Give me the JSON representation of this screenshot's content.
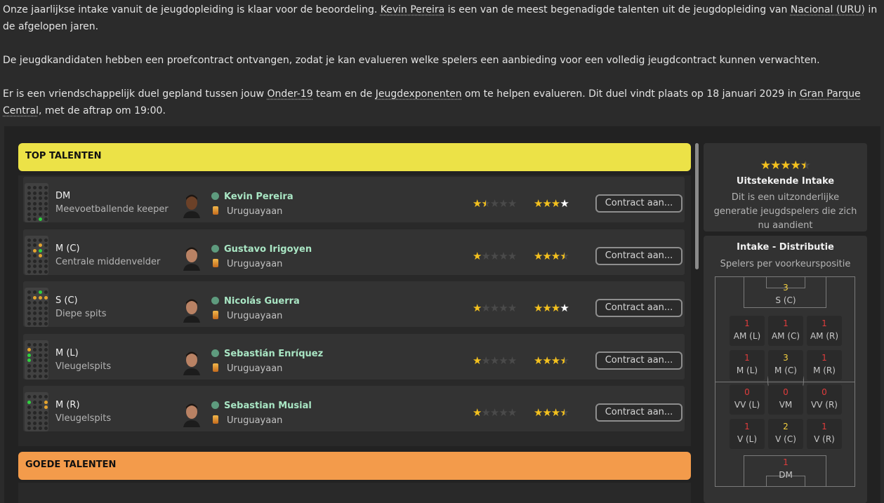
{
  "intro": {
    "p1_a": "Onze jaarlijkse intake vanuit de jeugdopleiding is klaar voor de beoordeling. ",
    "p1_link1": "Kevin Pereira",
    "p1_b": " is een van de meest begenadigde talenten uit de jeugdopleiding van ",
    "p1_link2": "Nacional (URU)",
    "p1_c": " in de afgelopen jaren.",
    "p2": "De jeugdkandidaten hebben een proefcontract ontvangen, zodat je kan evalueren welke spelers een aanbieding voor een volledig jeugdcontract kunnen verwachten.",
    "p3_a": "Er is een vriendschappelijk duel gepland tussen jouw ",
    "p3_link1": "Onder-19",
    "p3_b": " team en de ",
    "p3_link2": "Jeugdexponenten",
    "p3_c": " om te helpen evalueren. Dit duel vindt plaats op 18 januari 2029 in ",
    "p3_link3": "Gran Parque Central",
    "p3_d": ", met de aftrap om 19:00."
  },
  "sections": {
    "top_label": "TOP TALENTEN",
    "good_label": "GOEDE TALENTEN"
  },
  "players": [
    {
      "pos": "DM",
      "role": "Meevoetballende keeper",
      "name": "Kevin Pereira",
      "nationality": "Uruguayaan",
      "current_stars": 1.5,
      "potential_stars": 4,
      "button": "Contract aan..."
    },
    {
      "pos": "M (C)",
      "role": "Centrale middenvelder",
      "name": "Gustavo Irigoyen",
      "nationality": "Uruguayaan",
      "current_stars": 1,
      "potential_stars": 3.5,
      "button": "Contract aan..."
    },
    {
      "pos": "S (C)",
      "role": "Diepe spits",
      "name": "Nicolás Guerra",
      "nationality": "Uruguayaan",
      "current_stars": 1,
      "potential_stars": 4,
      "button": "Contract aan..."
    },
    {
      "pos": "M (L)",
      "role": "Vleugelspits",
      "name": "Sebastián Enríquez",
      "nationality": "Uruguayaan",
      "current_stars": 1,
      "potential_stars": 3.5,
      "button": "Contract aan..."
    },
    {
      "pos": "M (R)",
      "role": "Vleugelspits",
      "name": "Sebastian Musial",
      "nationality": "Uruguayaan",
      "current_stars": 1,
      "potential_stars": 3.5,
      "button": "Contract aan..."
    }
  ],
  "intake_card": {
    "stars": 4.5,
    "title": "Uitstekende Intake",
    "desc": "Dit is een uitzonderlijke generatie jeugdspelers die zich nu aandient"
  },
  "distribution": {
    "title": "Intake - Distributie",
    "subtitle": "Spelers per voorkeurspositie",
    "positions": [
      {
        "label": "S (C)",
        "count": "3"
      },
      {
        "label": "AM (L)",
        "count": "1"
      },
      {
        "label": "AM (C)",
        "count": "1"
      },
      {
        "label": "AM (R)",
        "count": "1"
      },
      {
        "label": "M (L)",
        "count": "1"
      },
      {
        "label": "M (C)",
        "count": "3"
      },
      {
        "label": "M (R)",
        "count": "1"
      },
      {
        "label": "VV (L)",
        "count": "0"
      },
      {
        "label": "VM",
        "count": "0"
      },
      {
        "label": "VV (R)",
        "count": "0"
      },
      {
        "label": "V (L)",
        "count": "1"
      },
      {
        "label": "V (C)",
        "count": "2"
      },
      {
        "label": "V (R)",
        "count": "1"
      },
      {
        "label": "DM",
        "count": "1"
      }
    ]
  },
  "colors": {
    "top_header": "#ece247",
    "good_header": "#f39b4b",
    "player_name": "#a9e6c4",
    "star": "#f4c11e"
  }
}
